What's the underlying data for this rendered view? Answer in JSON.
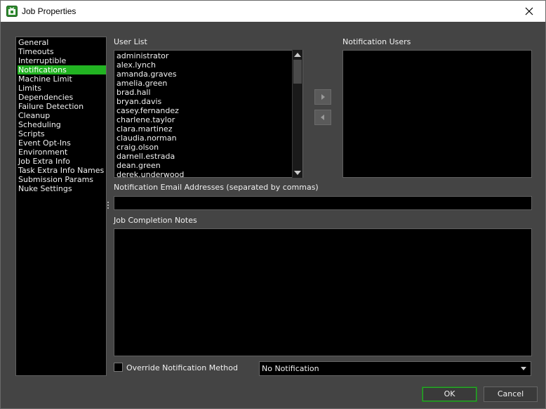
{
  "window": {
    "title": "Job Properties",
    "close_symbol": "✕"
  },
  "nav": {
    "items": [
      {
        "label": "General"
      },
      {
        "label": "Timeouts"
      },
      {
        "label": "Interruptible"
      },
      {
        "label": "Notifications",
        "selected": true
      },
      {
        "label": "Machine Limit"
      },
      {
        "label": "Limits"
      },
      {
        "label": "Dependencies"
      },
      {
        "label": "Failure Detection"
      },
      {
        "label": "Cleanup"
      },
      {
        "label": "Scheduling"
      },
      {
        "label": "Scripts"
      },
      {
        "label": "Event Opt-Ins"
      },
      {
        "label": "Environment"
      },
      {
        "label": "Job Extra Info"
      },
      {
        "label": "Task Extra Info Names"
      },
      {
        "label": "Submission Params"
      },
      {
        "label": "Nuke Settings"
      }
    ],
    "selected_color": "#22b322"
  },
  "user_list": {
    "label": "User List",
    "users": [
      "administrator",
      "alex.lynch",
      "amanda.graves",
      "amelia.green",
      "brad.hall",
      "bryan.davis",
      "casey.fernandez",
      "charlene.taylor",
      "clara.martinez",
      "claudia.norman",
      "craig.olson",
      "darnell.estrada",
      "dean.green",
      "derek.underwood"
    ]
  },
  "notification_users": {
    "label": "Notification Users"
  },
  "email": {
    "label": "Notification Email Addresses (separated by commas)",
    "value": ""
  },
  "notes": {
    "label": "Job Completion Notes",
    "value": ""
  },
  "override": {
    "label": "Override Notification Method",
    "checked": false
  },
  "notification_method": {
    "selected": "No Notification"
  },
  "buttons": {
    "ok": "OK",
    "cancel": "Cancel"
  }
}
